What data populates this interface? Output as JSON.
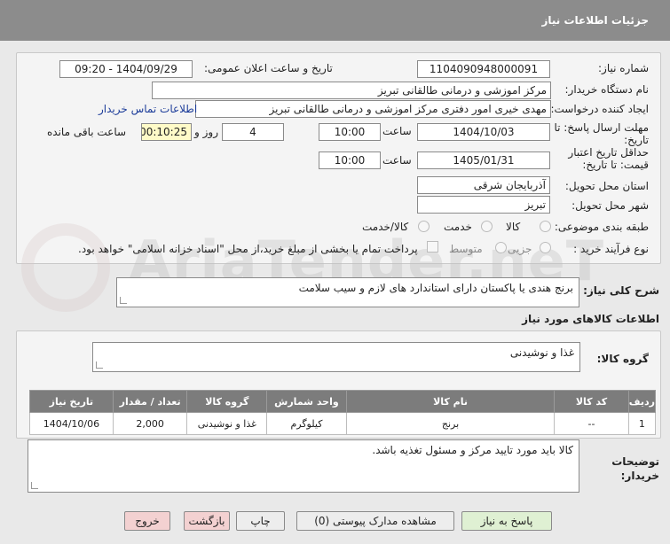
{
  "header": {
    "title": "جزئیات اطلاعات نیاز"
  },
  "form": {
    "need_number_label": "شماره نیاز:",
    "need_number": "1104090948000091",
    "announce_label": "تاریخ و ساعت اعلان عمومی:",
    "announce_value": "1404/09/29 - 09:20",
    "buyer_org_label": "نام دستگاه خریدار:",
    "buyer_org": "مرکز اموزشی و درمانی طالقانی تبریز",
    "requester_label": "ایجاد کننده درخواست:",
    "requester": "مهدی خیری امور دفتری مرکز اموزشی و درمانی طالقانی تبریز",
    "contact_link": "اطلاعات تماس خریدار",
    "send_deadline_label_1": "مهلت ارسال پاسخ: تا",
    "send_deadline_label_2": "تاریخ:",
    "send_date": "1404/10/03",
    "time_label": "ساعت",
    "send_time": "10:00",
    "days_value": "4",
    "days_label": "روز و",
    "remaining_time": "00:10:25",
    "remaining_label": "ساعت باقی مانده",
    "validity_label_1": "حداقل تاریخ اعتبار",
    "validity_label_2": "قیمت: تا تاریخ:",
    "validity_date": "1405/01/31",
    "validity_time": "10:00",
    "province_label": "استان محل تحویل:",
    "province": "آذربایجان شرقی",
    "city_label": "شهر محل تحویل:",
    "city": "تبریز",
    "category_label": "طبقه بندی موضوعی:",
    "category_options": [
      "کالا",
      "خدمت",
      "کالا/خدمت"
    ],
    "process_label": "نوع فرآیند خرید :",
    "process_options": [
      "جزیی",
      "متوسط"
    ],
    "payment_note": "پرداخت تمام یا بخشی از مبلغ خرید،از محل \"اسناد خزانه اسلامی\" خواهد بود."
  },
  "summary": {
    "label": "شرح کلی نیاز:",
    "value": "برنج هندی یا پاکستان دارای استاندارد های لازم و سیب سلامت"
  },
  "goods": {
    "section_title": "اطلاعات کالاهای مورد نیاز",
    "group_label": "گروه کالا:",
    "group_value": "غذا و نوشیدنی",
    "columns": [
      "ردیف",
      "کد کالا",
      "نام کالا",
      "واحد شمارش",
      "گروه کالا",
      "تعداد / مقدار",
      "تاریخ نیاز"
    ],
    "rows": [
      [
        "1",
        "--",
        "برنج",
        "کیلوگرم",
        "غذا و نوشیدنی",
        "2,000",
        "1404/10/06"
      ]
    ]
  },
  "buyer_notes": {
    "label_1": "توضیحات",
    "label_2": "خریدار:",
    "value": "کالا باید مورد تایید مرکز و مسئول تغذیه باشد."
  },
  "buttons": {
    "reply": "پاسخ به نیاز",
    "attachments": "مشاهده مدارک پیوستی (0)",
    "print": "چاپ",
    "back": "بازگشت",
    "exit": "خروج"
  },
  "watermark": "AriaTender.neT"
}
